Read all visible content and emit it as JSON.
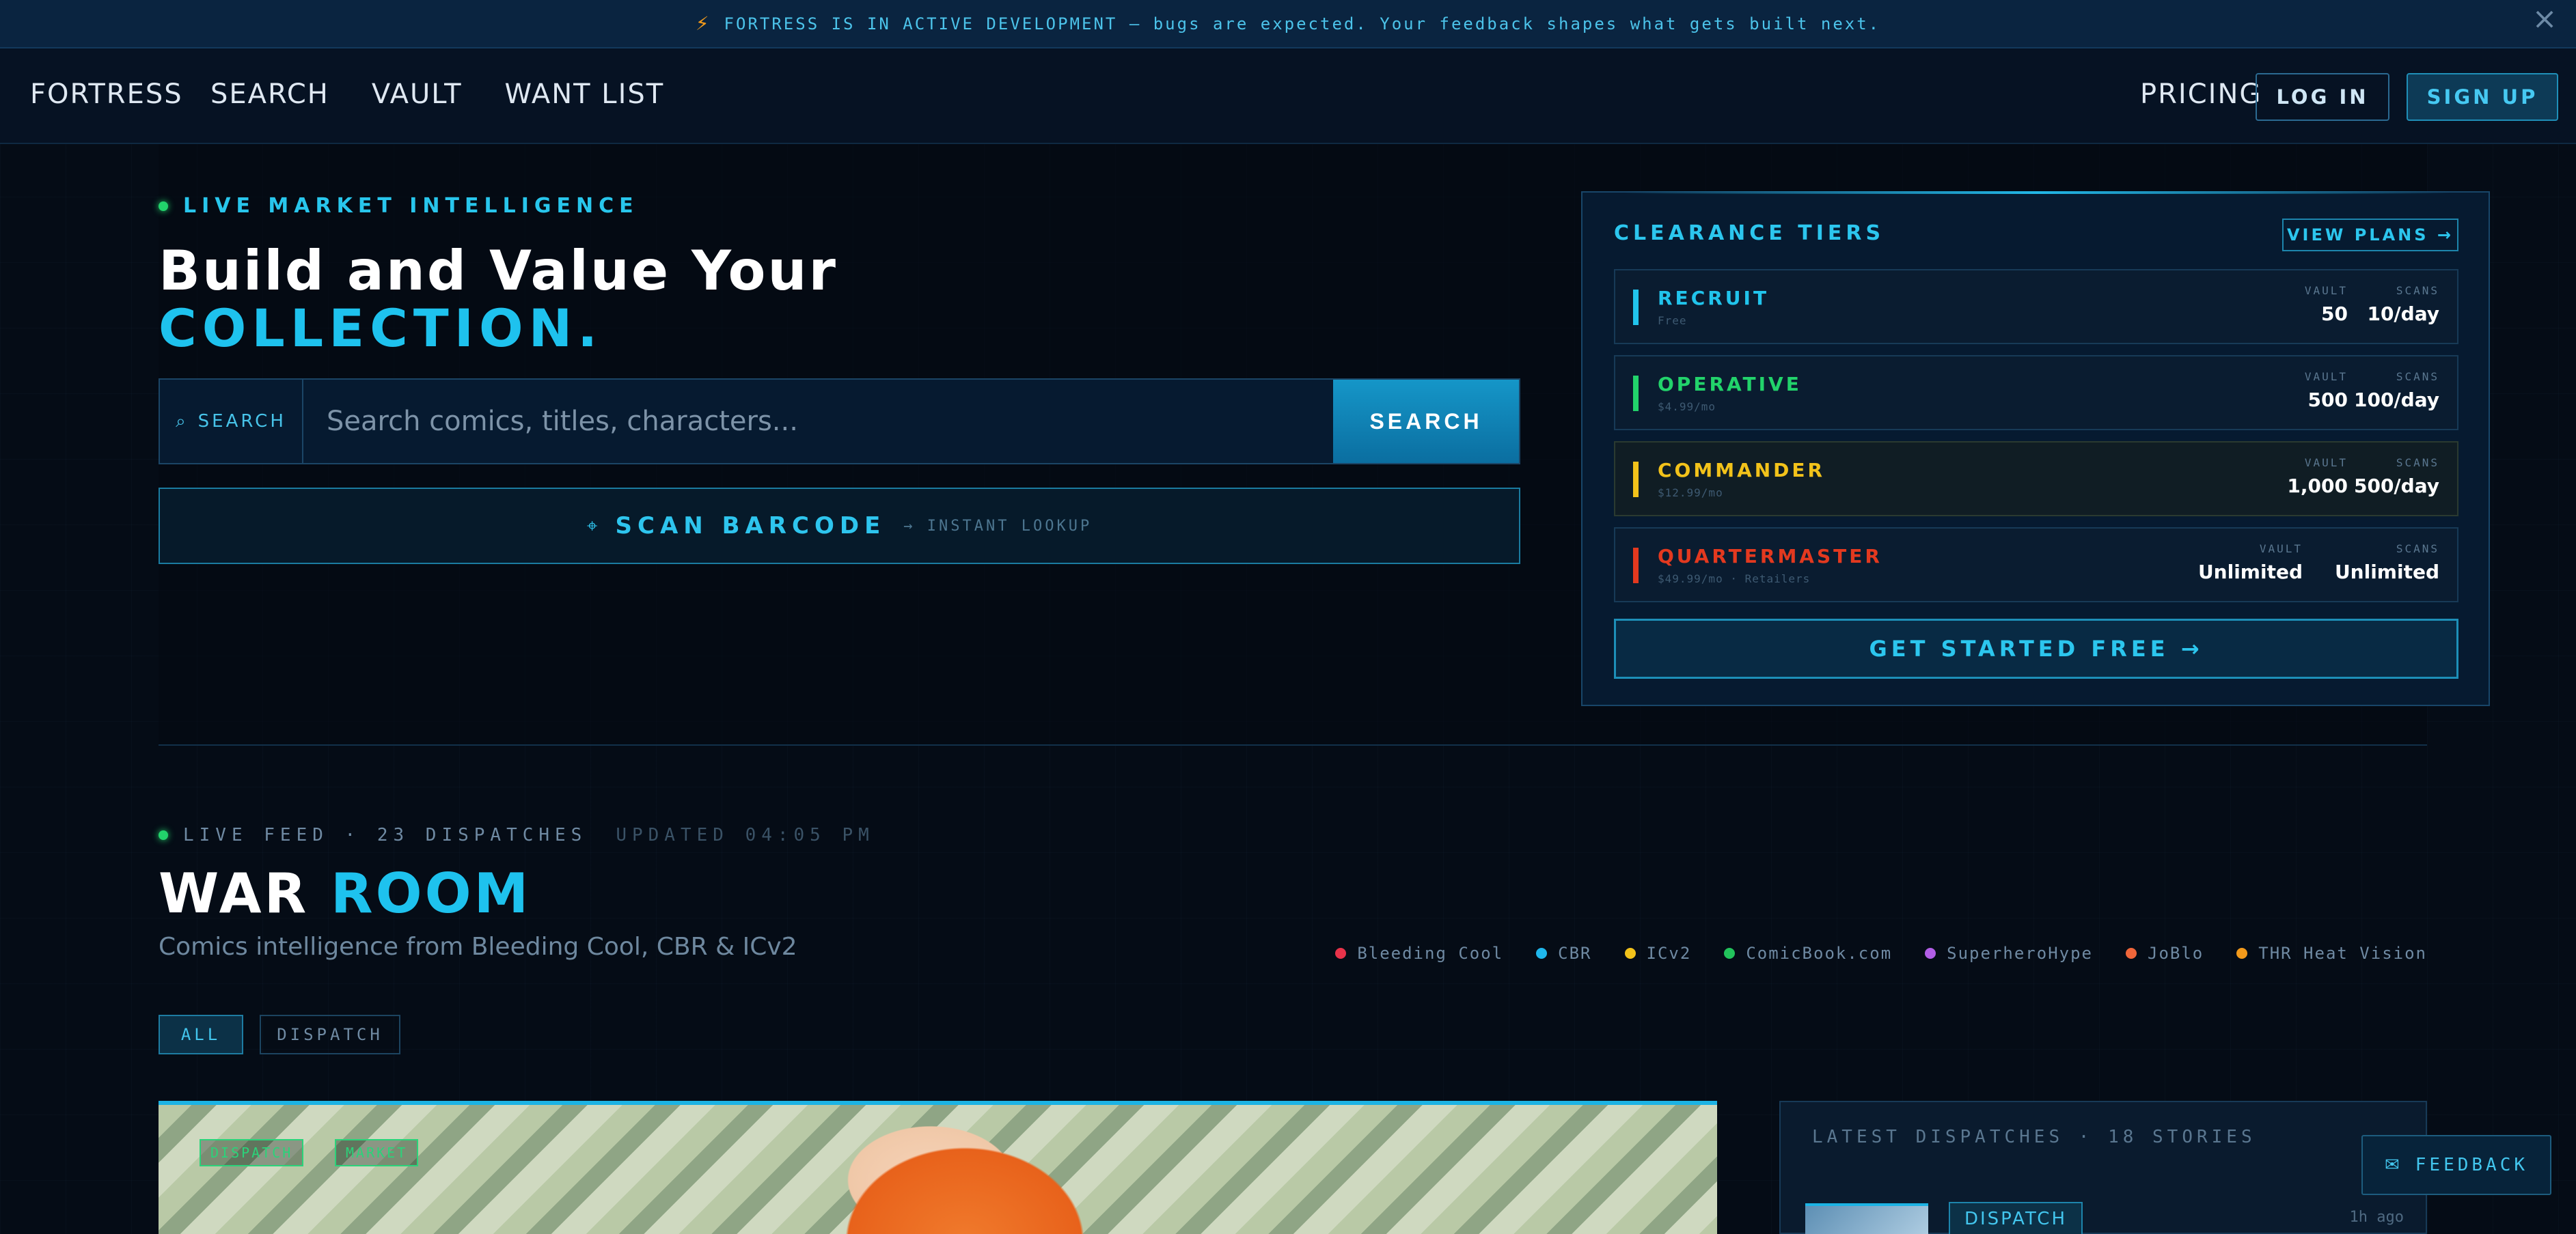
{
  "announcement": {
    "icon": "lightning-bolt-icon",
    "text": "FORTRESS IS IN ACTIVE DEVELOPMENT — bugs are expected. Your feedback shapes what gets built next.",
    "close_icon": "close-icon"
  },
  "nav": {
    "logo": "FORTRESS",
    "links": [
      "SEARCH",
      "VAULT",
      "WANT LIST"
    ],
    "pricing": "PRICING",
    "login": "LOG IN",
    "signup": "SIGN UP"
  },
  "hero": {
    "eyebrow": "LIVE MARKET INTELLIGENCE",
    "title_line1": "Build and Value Your",
    "title_line2": "COLLECTION.",
    "search": {
      "label": "SEARCH",
      "placeholder": "Search comics, titles, characters...",
      "button": "SEARCH"
    },
    "scan": {
      "label": "SCAN BARCODE",
      "sub": "→ INSTANT LOOKUP"
    }
  },
  "clearance": {
    "title": "CLEARANCE TIERS",
    "view_plans": "VIEW PLANS →",
    "col_vault": "VAULT",
    "col_scans": "SCANS",
    "tiers": [
      {
        "name": "RECRUIT",
        "price": "Free",
        "vault": "50",
        "scans": "10/day",
        "color": "#21c4ec"
      },
      {
        "name": "OPERATIVE",
        "price": "$4.99/mo",
        "vault": "500",
        "scans": "100/day",
        "color": "#22d36b"
      },
      {
        "name": "COMMANDER",
        "price": "$12.99/mo",
        "vault": "1,000",
        "scans": "500/day",
        "color": "#f2c21a"
      },
      {
        "name": "QUARTERMASTER",
        "price": "$49.99/mo · Retailers",
        "vault": "Unlimited",
        "scans": "Unlimited",
        "color": "#e3391f"
      }
    ],
    "cta": "GET STARTED FREE →"
  },
  "warroom": {
    "feed_status": "LIVE FEED · 23 DISPATCHES",
    "updated": "UPDATED 04:05 PM",
    "title_a": "WAR",
    "title_b": "ROOM",
    "subtitle": "Comics intelligence from Bleeding Cool, CBR & ICv2",
    "sources": [
      {
        "name": "Bleeding Cool",
        "color": "#e8334a"
      },
      {
        "name": "CBR",
        "color": "#1fb7ec"
      },
      {
        "name": "ICv2",
        "color": "#f2c21a"
      },
      {
        "name": "ComicBook.com",
        "color": "#22c35b"
      },
      {
        "name": "SuperheroHype",
        "color": "#b25ee6"
      },
      {
        "name": "JoBlo",
        "color": "#f0663a"
      },
      {
        "name": "THR Heat Vision",
        "color": "#f39a1b"
      }
    ],
    "filters": [
      "ALL",
      "DISPATCH"
    ],
    "feature_tags": [
      "DISPATCH",
      "MARKET"
    ],
    "latest": {
      "header": "LATEST DISPATCHES · 18 STORIES",
      "first_badge": "DISPATCH",
      "first_time": "1h ago"
    }
  },
  "feedback": {
    "icon": "mail-icon",
    "label": "FEEDBACK"
  }
}
